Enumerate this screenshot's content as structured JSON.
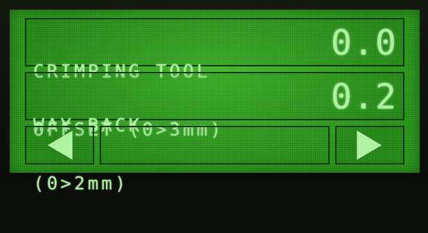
{
  "screen": {
    "items": [
      {
        "label_line1": "CRIMPING TOOL",
        "label_line2": "OFFSET (0>3mm)",
        "value": "0.0"
      },
      {
        "label_line1": "WAY BACK",
        "label_line2": "(0>2mm)",
        "value": "0.2"
      }
    ],
    "nav": {
      "prev_icon": "left-triangle-icon",
      "next_icon": "right-triangle-icon"
    },
    "colors": {
      "lcd_background": "#2f9c1f",
      "lcd_text": "#aef3a0",
      "lcd_lines": "#0e3a08"
    }
  }
}
